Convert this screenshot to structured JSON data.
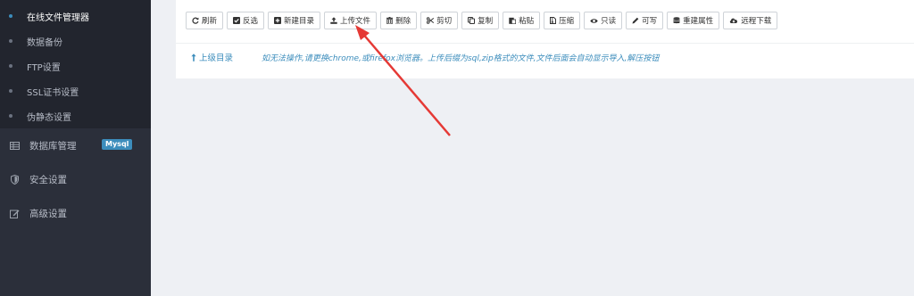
{
  "sidebar": {
    "sub_items": [
      {
        "label": "在线文件管理器",
        "active": true
      },
      {
        "label": "数据备份",
        "active": false
      },
      {
        "label": "FTP设置",
        "active": false
      },
      {
        "label": "SSL证书设置",
        "active": false
      },
      {
        "label": "伪静态设置",
        "active": false
      }
    ],
    "items": [
      {
        "label": "数据库管理",
        "icon": "database-icon",
        "badge": "Mysql"
      },
      {
        "label": "安全设置",
        "icon": "shield-icon"
      },
      {
        "label": "高级设置",
        "icon": "edit-icon"
      }
    ]
  },
  "toolbar": {
    "buttons": [
      {
        "label": "刷新",
        "icon": "refresh-icon"
      },
      {
        "label": "反选",
        "icon": "checkbox-icon"
      },
      {
        "label": "新建目录",
        "icon": "plus-square-icon"
      },
      {
        "label": "上传文件",
        "icon": "upload-icon"
      },
      {
        "label": "删除",
        "icon": "trash-icon"
      },
      {
        "label": "剪切",
        "icon": "scissors-icon"
      },
      {
        "label": "复制",
        "icon": "copy-icon"
      },
      {
        "label": "粘贴",
        "icon": "paste-icon"
      },
      {
        "label": "压缩",
        "icon": "archive-icon"
      },
      {
        "label": "只读",
        "icon": "eye-icon"
      },
      {
        "label": "可写",
        "icon": "pencil-icon"
      },
      {
        "label": "重建属性",
        "icon": "rebuild-icon"
      },
      {
        "label": "远程下载",
        "icon": "cloud-download-icon"
      }
    ]
  },
  "path": {
    "up_label": "上级目录",
    "notice": "如无法操作,请更换chrome,或firefox浏览器。上传后缀为sql,zip格式的文件,文件后面会自动显示导入,解压按钮"
  },
  "colors": {
    "accent": "#3c8dbc",
    "sidebar": "#2b2f3a",
    "arrow": "#e53935"
  }
}
